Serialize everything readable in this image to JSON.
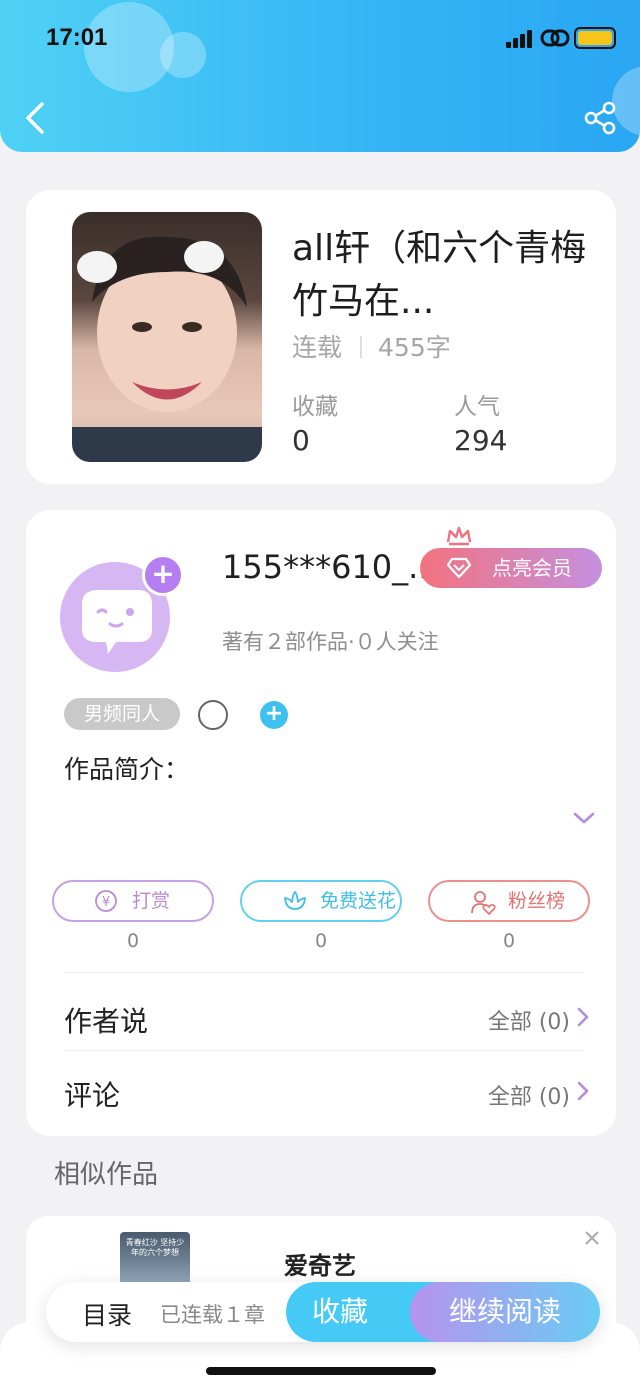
{
  "status_bar": {
    "time": "17:01"
  },
  "book": {
    "title": "all轩（和六个青梅竹马在...",
    "status": "连载",
    "word_count": "455字",
    "favorites_label": "收藏",
    "favorites_value": "0",
    "popularity_label": "人气",
    "popularity_value": "294"
  },
  "author": {
    "name": "155***610_...",
    "vip_label": "点亮会员",
    "subtitle": "著有２部作品·０人关注",
    "tag": "男频同人",
    "intro_label": "作品简介："
  },
  "actions": [
    {
      "label": "打赏",
      "count": "0",
      "color": "#b88ad8"
    },
    {
      "label": "免费送花",
      "count": "0",
      "color": "#4cc8ea"
    },
    {
      "label": "粉丝榜",
      "count": "0",
      "color": "#e87a7a"
    }
  ],
  "sections": {
    "author_says": {
      "title": "作者说",
      "link": "全部 (0)"
    },
    "comments": {
      "title": "评论",
      "link": "全部 (0)"
    }
  },
  "similar": {
    "heading": "相似作品",
    "item_name": "爱奇艺",
    "thumb_text": "青春红沙 坚持少年的六个梦想"
  },
  "bottom_bar": {
    "toc": "目录",
    "serial": "已连载１章",
    "favorite": "收藏",
    "continue": "继续阅读"
  },
  "colors": {
    "header_gradient_start": "#4fd1f5",
    "header_gradient_end": "#2aa6f3",
    "accent_purple": "#b67ff0",
    "accent_blue": "#45c9f5"
  }
}
